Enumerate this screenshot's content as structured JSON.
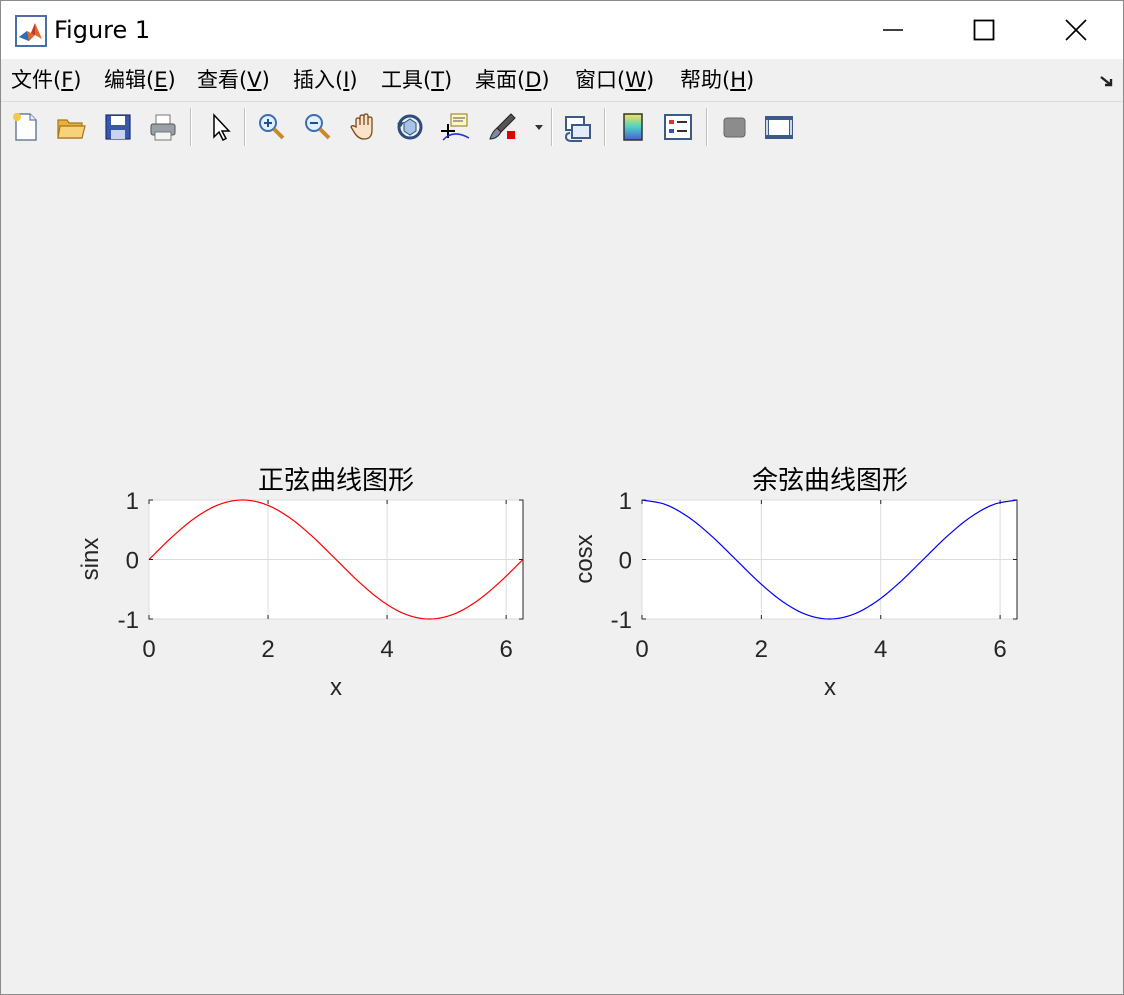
{
  "window": {
    "title": "Figure 1"
  },
  "menubar": {
    "items": [
      {
        "label": "文件(",
        "key": "F",
        "end": ")"
      },
      {
        "label": "编辑(",
        "key": "E",
        "end": ")"
      },
      {
        "label": "查看(",
        "key": "V",
        "end": ")"
      },
      {
        "label": "插入(",
        "key": "I",
        "end": ")"
      },
      {
        "label": "工具(",
        "key": "T",
        "end": ")"
      },
      {
        "label": "桌面(",
        "key": "D",
        "end": ")"
      },
      {
        "label": "窗口(",
        "key": "W",
        "end": ")"
      },
      {
        "label": "帮助(",
        "key": "H",
        "end": ")"
      }
    ]
  },
  "toolbar": {
    "icons": [
      "new-figure-icon",
      "open-file-icon",
      "save-icon",
      "print-icon",
      "edit-plot-icon",
      "zoom-in-icon",
      "zoom-out-icon",
      "pan-icon",
      "rotate-3d-icon",
      "data-cursor-icon",
      "brush-icon",
      "link-plot-icon",
      "colorbar-icon",
      "legend-icon",
      "hide-plot-tools-icon",
      "show-plot-tools-icon"
    ]
  },
  "chart_data": [
    {
      "type": "line",
      "title": "正弦曲线图形",
      "xlabel": "x",
      "ylabel": "sinx",
      "xlim": [
        0,
        6.2832
      ],
      "ylim": [
        -1,
        1
      ],
      "xticks": [
        0,
        2,
        4,
        6
      ],
      "yticks": [
        -1,
        0,
        1
      ],
      "grid": true,
      "series": [
        {
          "color": "#ff0000",
          "x": [
            0,
            0.393,
            0.785,
            1.178,
            1.571,
            1.963,
            2.356,
            2.749,
            3.142,
            3.534,
            3.927,
            4.32,
            4.712,
            5.105,
            5.498,
            5.89,
            6.283
          ],
          "y": [
            0,
            0.383,
            0.707,
            0.924,
            1,
            0.924,
            0.707,
            0.383,
            0,
            -0.383,
            -0.707,
            -0.924,
            -1,
            -0.924,
            -0.707,
            -0.383,
            0
          ]
        }
      ]
    },
    {
      "type": "line",
      "title": "余弦曲线图形",
      "xlabel": "x",
      "ylabel": "cosx",
      "xlim": [
        0,
        6.2832
      ],
      "ylim": [
        -1,
        1
      ],
      "xticks": [
        0,
        2,
        4,
        6
      ],
      "yticks": [
        -1,
        0,
        1
      ],
      "grid": true,
      "series": [
        {
          "color": "#0000ff",
          "x": [
            0,
            0.393,
            0.785,
            1.178,
            1.571,
            1.963,
            2.356,
            2.749,
            3.142,
            3.534,
            3.927,
            4.32,
            4.712,
            5.105,
            5.498,
            5.89,
            6.283
          ],
          "y": [
            1,
            0.924,
            0.707,
            0.383,
            0,
            -0.383,
            -0.707,
            -0.924,
            -1,
            -0.924,
            -0.707,
            -0.383,
            0,
            0.383,
            0.707,
            0.924,
            1
          ]
        }
      ]
    }
  ]
}
